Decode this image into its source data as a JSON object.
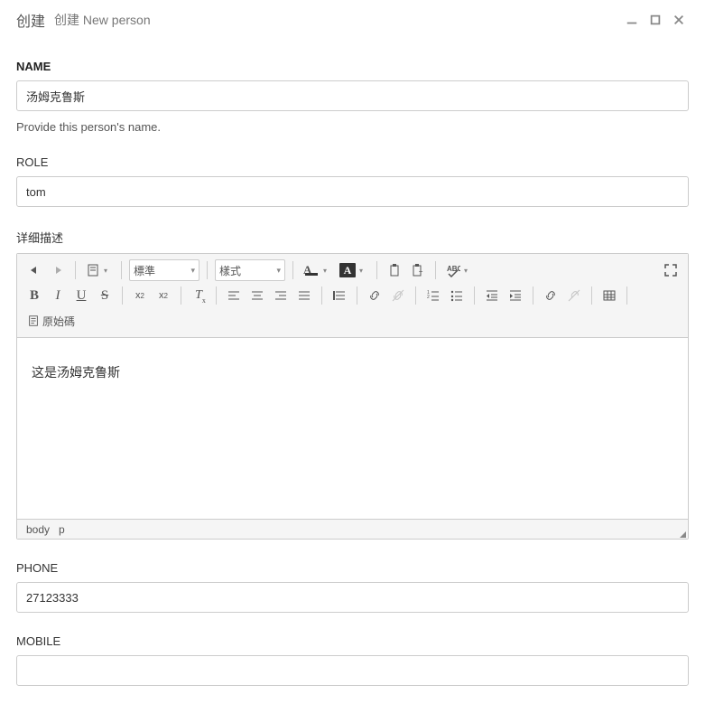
{
  "window": {
    "title_main": "创建",
    "title_sub": "创建 New person"
  },
  "fields": {
    "name": {
      "label": "NAME",
      "value": "汤姆克鲁斯",
      "help": "Provide this person's name."
    },
    "role": {
      "label": "ROLE",
      "value": "tom"
    },
    "description": {
      "label": "详细描述",
      "content": "这是汤姆克鲁斯",
      "path_body": "body",
      "path_p": "p"
    },
    "phone": {
      "label": "PHONE",
      "value": "27123333"
    },
    "mobile": {
      "label": "MOBILE",
      "value": ""
    }
  },
  "editor": {
    "format_select": "標準",
    "style_select": "樣式",
    "source_label": "原始碼"
  }
}
